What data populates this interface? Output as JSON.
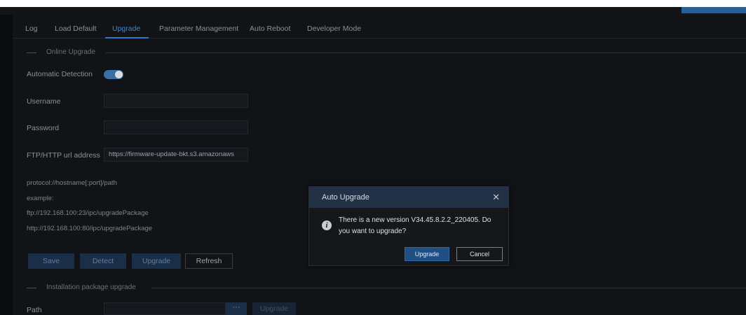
{
  "tabs": [
    "Log",
    "Load Default",
    "Upgrade",
    "Parameter Management",
    "Auto Reboot",
    "Developer Mode"
  ],
  "active_tab": "Upgrade",
  "online_section": {
    "title": "Online Upgrade"
  },
  "form": {
    "auto_detection_label": "Automatic Detection",
    "auto_detection_on": true,
    "username_label": "Username",
    "username_value": "",
    "password_label": "Password",
    "password_value": "",
    "ftp_label": "FTP/HTTP url address",
    "ftp_value": "https://firmware-update-bkt.s3.amazonaws"
  },
  "help": {
    "format": "protocol://hostname[:port]/path",
    "example_label": "example:",
    "example_ftp": "ftp://192.168.100:23/ipc/upgradePackage",
    "example_http": "http://192.168.100:80/ipc/upgradePackage"
  },
  "actions": {
    "save": "Save",
    "detect": "Detect",
    "upgrade": "Upgrade",
    "refresh": "Refresh"
  },
  "package_section": {
    "title": "Installation package upgrade"
  },
  "package": {
    "path_label": "Path",
    "browse": "···",
    "upgrade": "Upgrade"
  },
  "dialog": {
    "title": "Auto Upgrade",
    "close": "✕",
    "icon": "info-icon",
    "message": "There is a new version V34.45.8.2.2_220405. Do you want to upgrade?",
    "ok": "Upgrade",
    "cancel": "Cancel"
  },
  "colors": {
    "accent": "#2d79c4",
    "dialog_header": "#233146",
    "background": "#111317"
  }
}
